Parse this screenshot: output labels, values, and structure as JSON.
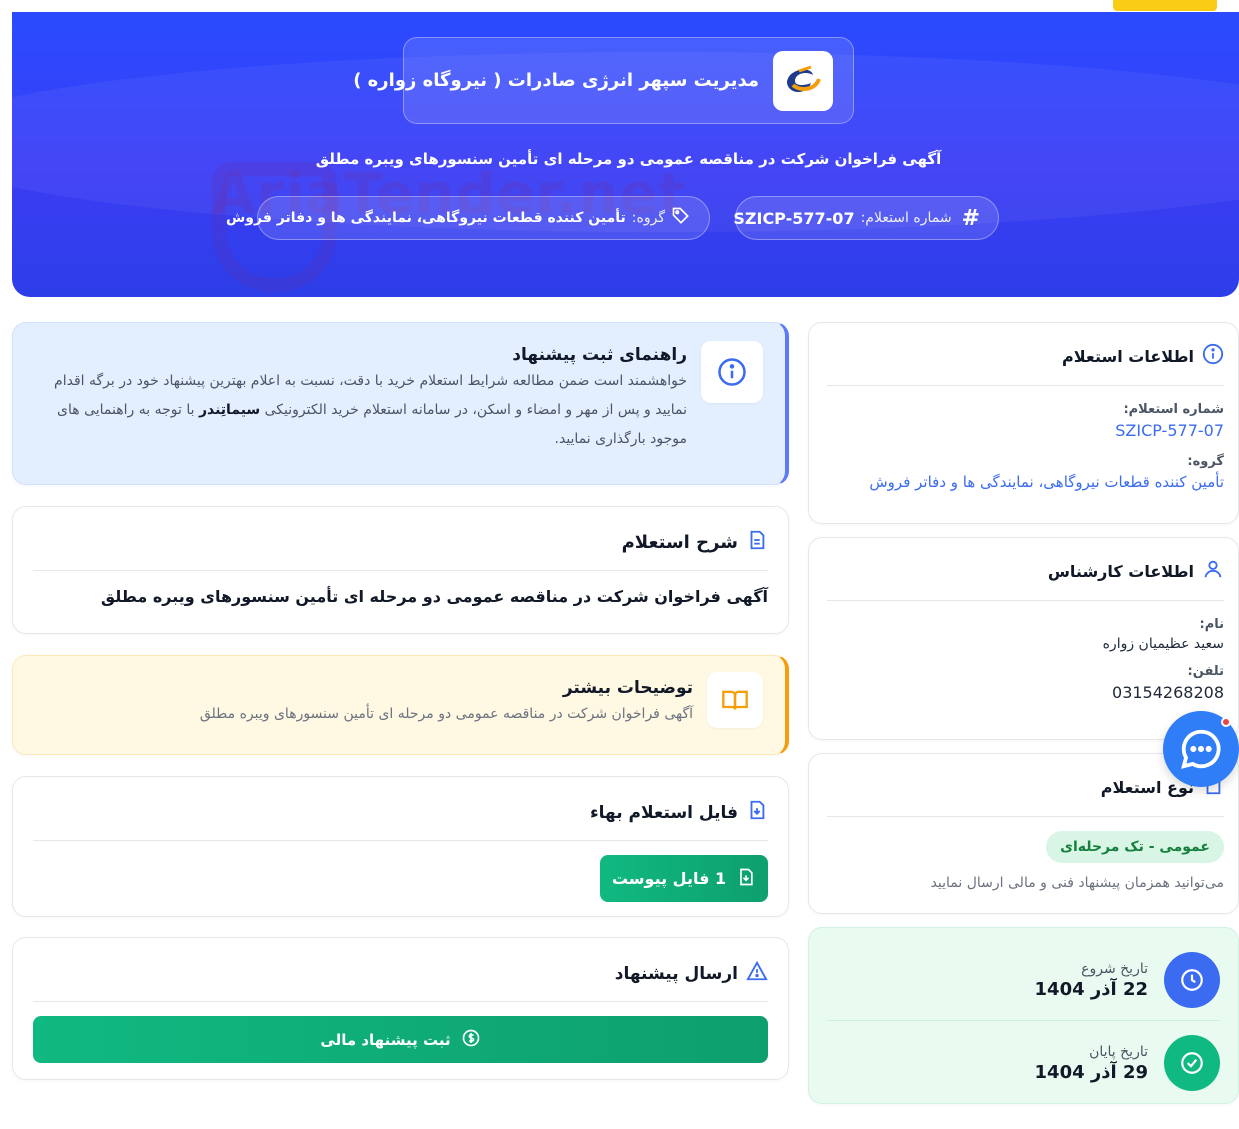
{
  "header": {
    "company_name": "مدیریت سپهر انرژی صادرات ( نیروگاه زواره )",
    "title": "آگهی فراخوان شرکت در مناقصه عمومی دو مرحله ای تأمین سنسورهای ویبره مطلق",
    "inquiry_number_label": "شماره استعلام:",
    "inquiry_number": "SZICP-577-07",
    "group_label": "گروه:",
    "group_value": "تأمین کننده قطعات نیروگاهی، نمایندگی ها و دفاتر فروش",
    "watermark": "AriaTender.net"
  },
  "inquiry_info": {
    "title": "اطلاعات استعلام",
    "number_label": "شماره استعلام:",
    "number_value": "SZICP-577-07",
    "group_label": "گروه:",
    "group_value": "تأمین کننده قطعات نیروگاهی، نمایندگی ها و دفاتر فروش"
  },
  "expert_info": {
    "title": "اطلاعات کارشناس",
    "name_label": "نام:",
    "name_value": "سعید عظیمیان زواره",
    "phone_label": "تلفن:",
    "phone_value": "03154268208"
  },
  "inquiry_type": {
    "title": "نوع استعلام",
    "badge": "عمومی - تک مرحله‌ای",
    "note": "می‌توانید همزمان پیشنهاد فنی و مالی ارسال نمایید"
  },
  "dates": {
    "start_label": "تاریخ شروع",
    "start_value": "22 آذر 1404",
    "end_label": "تاریخ پایان",
    "end_value": "29 آذر 1404"
  },
  "guide": {
    "title": "راهنمای ثبت پیشنهاد",
    "text_part1": "خواهشمند است ضمن مطالعه شرایط استعلام خرید با دقت، نسبت به اعلام بهترین پیشنهاد خود در برگه اقدام نمایید و پس از مهر و امضاء و اسکن، در سامانه استعلام خرید الکترونیکی ",
    "brand": "سیماتِندر",
    "text_part2": " با توجه به راهنمایی های موجود بارگذاری نمایید."
  },
  "description": {
    "title": "شرح استعلام",
    "text": "آگهی فراخوان شرکت در مناقصه عمومی دو مرحله ای تأمین سنسورهای ویبره مطلق"
  },
  "more": {
    "title": "توضیحات بیشتر",
    "text": "آگهی فراخوان شرکت در مناقصه عمومی دو مرحله ای تأمین سنسورهای ویبره مطلق"
  },
  "price_file": {
    "title": "فایل استعلام بهاء",
    "button": "1 فایل پیوست"
  },
  "submit": {
    "title": "ارسال پیشنهاد",
    "button": "ثبت پیشنهاد مالی"
  },
  "colors": {
    "primary": "#2f49f7",
    "accent_yellow": "#facc15",
    "green": "#10b981",
    "blue_link": "#3b6bf0"
  }
}
